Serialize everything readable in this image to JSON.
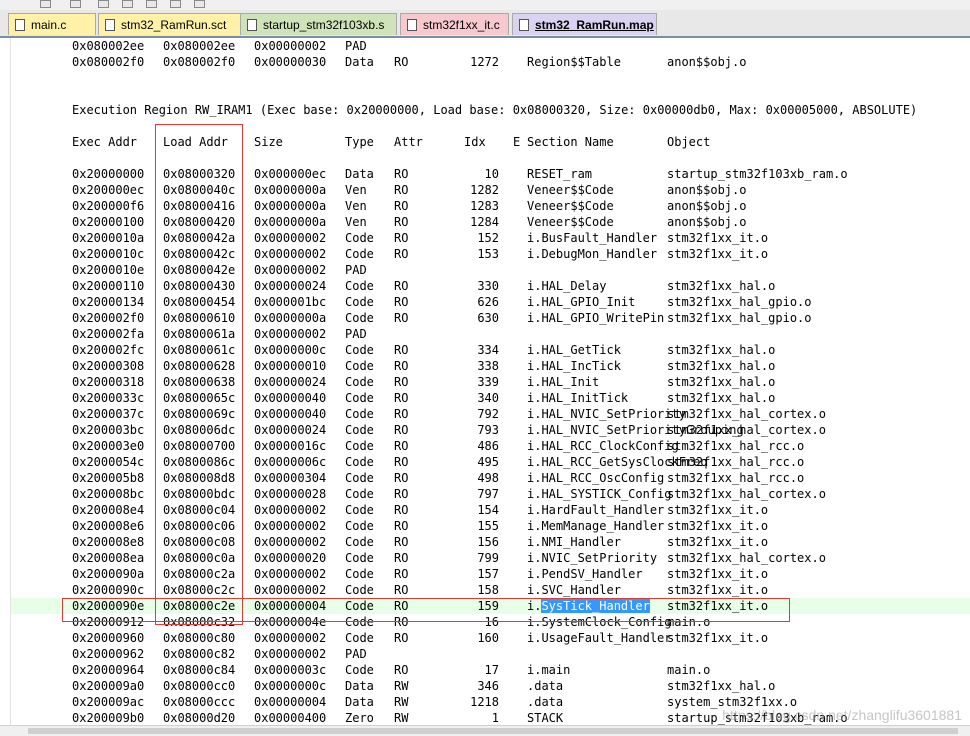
{
  "tabs": [
    {
      "label": "main.c",
      "color": "#fff2a8",
      "active": false
    },
    {
      "label": "stm32_RamRun.sct",
      "color": "#fff2a8",
      "active": false
    },
    {
      "label": "startup_stm32f103xb.s",
      "color": "#cfe3b8",
      "active": false
    },
    {
      "label": "stm32f1xx_it.c",
      "color": "#f7c9cf",
      "active": false
    },
    {
      "label": "stm32_RamRun.map",
      "color": "#d9d2f0",
      "active": true
    }
  ],
  "pre_lines": [
    [
      "0x080002ee",
      "0x080002ee",
      "0x00000002",
      "PAD",
      "",
      "",
      "",
      ""
    ],
    [
      "0x080002f0",
      "0x080002f0",
      "0x00000030",
      "Data",
      "RO",
      "1272",
      "Region$$Table",
      "anon$$obj.o"
    ]
  ],
  "execution_region": "Execution Region RW_IRAM1 (Exec base: 0x20000000, Load base: 0x08000320, Size: 0x00000db0, Max: 0x00005000, ABSOLUTE)",
  "columns": {
    "exec": "Exec Addr",
    "load": "Load Addr",
    "size": "Size",
    "type": "Type",
    "attr": "Attr",
    "idx": "Idx",
    "e": "E",
    "section": "Section Name",
    "object": "Object"
  },
  "rows": [
    [
      "0x20000000",
      "0x08000320",
      "0x000000ec",
      "Data",
      "RO",
      "10",
      "RESET_ram",
      "startup_stm32f103xb_ram.o"
    ],
    [
      "0x200000ec",
      "0x0800040c",
      "0x0000000a",
      "Ven",
      "RO",
      "1282",
      "Veneer$$Code",
      "anon$$obj.o"
    ],
    [
      "0x200000f6",
      "0x08000416",
      "0x0000000a",
      "Ven",
      "RO",
      "1283",
      "Veneer$$Code",
      "anon$$obj.o"
    ],
    [
      "0x20000100",
      "0x08000420",
      "0x0000000a",
      "Ven",
      "RO",
      "1284",
      "Veneer$$Code",
      "anon$$obj.o"
    ],
    [
      "0x2000010a",
      "0x0800042a",
      "0x00000002",
      "Code",
      "RO",
      "152",
      "i.BusFault_Handler",
      "stm32f1xx_it.o"
    ],
    [
      "0x2000010c",
      "0x0800042c",
      "0x00000002",
      "Code",
      "RO",
      "153",
      "i.DebugMon_Handler",
      "stm32f1xx_it.o"
    ],
    [
      "0x2000010e",
      "0x0800042e",
      "0x00000002",
      "PAD",
      "",
      "",
      "",
      ""
    ],
    [
      "0x20000110",
      "0x08000430",
      "0x00000024",
      "Code",
      "RO",
      "330",
      "i.HAL_Delay",
      "stm32f1xx_hal.o"
    ],
    [
      "0x20000134",
      "0x08000454",
      "0x000001bc",
      "Code",
      "RO",
      "626",
      "i.HAL_GPIO_Init",
      "stm32f1xx_hal_gpio.o"
    ],
    [
      "0x200002f0",
      "0x08000610",
      "0x0000000a",
      "Code",
      "RO",
      "630",
      "i.HAL_GPIO_WritePin",
      "stm32f1xx_hal_gpio.o"
    ],
    [
      "0x200002fa",
      "0x0800061a",
      "0x00000002",
      "PAD",
      "",
      "",
      "",
      ""
    ],
    [
      "0x200002fc",
      "0x0800061c",
      "0x0000000c",
      "Code",
      "RO",
      "334",
      "i.HAL_GetTick",
      "stm32f1xx_hal.o"
    ],
    [
      "0x20000308",
      "0x08000628",
      "0x00000010",
      "Code",
      "RO",
      "338",
      "i.HAL_IncTick",
      "stm32f1xx_hal.o"
    ],
    [
      "0x20000318",
      "0x08000638",
      "0x00000024",
      "Code",
      "RO",
      "339",
      "i.HAL_Init",
      "stm32f1xx_hal.o"
    ],
    [
      "0x2000033c",
      "0x0800065c",
      "0x00000040",
      "Code",
      "RO",
      "340",
      "i.HAL_InitTick",
      "stm32f1xx_hal.o"
    ],
    [
      "0x2000037c",
      "0x0800069c",
      "0x00000040",
      "Code",
      "RO",
      "792",
      "i.HAL_NVIC_SetPriority",
      "stm32f1xx_hal_cortex.o"
    ],
    [
      "0x200003bc",
      "0x080006dc",
      "0x00000024",
      "Code",
      "RO",
      "793",
      "i.HAL_NVIC_SetPriorityGrouping",
      "stm32f1xx_hal_cortex.o"
    ],
    [
      "0x200003e0",
      "0x08000700",
      "0x0000016c",
      "Code",
      "RO",
      "486",
      "i.HAL_RCC_ClockConfig",
      "stm32f1xx_hal_rcc.o"
    ],
    [
      "0x2000054c",
      "0x0800086c",
      "0x0000006c",
      "Code",
      "RO",
      "495",
      "i.HAL_RCC_GetSysClockFreq",
      "stm32f1xx_hal_rcc.o"
    ],
    [
      "0x200005b8",
      "0x080008d8",
      "0x00000304",
      "Code",
      "RO",
      "498",
      "i.HAL_RCC_OscConfig",
      "stm32f1xx_hal_rcc.o"
    ],
    [
      "0x200008bc",
      "0x08000bdc",
      "0x00000028",
      "Code",
      "RO",
      "797",
      "i.HAL_SYSTICK_Config",
      "stm32f1xx_hal_cortex.o"
    ],
    [
      "0x200008e4",
      "0x08000c04",
      "0x00000002",
      "Code",
      "RO",
      "154",
      "i.HardFault_Handler",
      "stm32f1xx_it.o"
    ],
    [
      "0x200008e6",
      "0x08000c06",
      "0x00000002",
      "Code",
      "RO",
      "155",
      "i.MemManage_Handler",
      "stm32f1xx_it.o"
    ],
    [
      "0x200008e8",
      "0x08000c08",
      "0x00000002",
      "Code",
      "RO",
      "156",
      "i.NMI_Handler",
      "stm32f1xx_it.o"
    ],
    [
      "0x200008ea",
      "0x08000c0a",
      "0x00000020",
      "Code",
      "RO",
      "799",
      "i.NVIC_SetPriority",
      "stm32f1xx_hal_cortex.o"
    ],
    [
      "0x2000090a",
      "0x08000c2a",
      "0x00000002",
      "Code",
      "RO",
      "157",
      "i.PendSV_Handler",
      "stm32f1xx_it.o"
    ],
    [
      "0x2000090c",
      "0x08000c2c",
      "0x00000002",
      "Code",
      "RO",
      "158",
      "i.SVC_Handler",
      "stm32f1xx_it.o"
    ],
    [
      "0x2000090e",
      "0x08000c2e",
      "0x00000004",
      "Code",
      "RO",
      "159",
      "i.SysTick_Handler",
      "stm32f1xx_it.o"
    ],
    [
      "0x20000912",
      "0x08000c32",
      "0x0000004e",
      "Code",
      "RO",
      "16",
      "i.SystemClock_Config",
      "main.o"
    ],
    [
      "0x20000960",
      "0x08000c80",
      "0x00000002",
      "Code",
      "RO",
      "160",
      "i.UsageFault_Handler",
      "stm32f1xx_it.o"
    ],
    [
      "0x20000962",
      "0x08000c82",
      "0x00000002",
      "PAD",
      "",
      "",
      "",
      ""
    ],
    [
      "0x20000964",
      "0x08000c84",
      "0x0000003c",
      "Code",
      "RO",
      "17",
      "i.main",
      "main.o"
    ],
    [
      "0x200009a0",
      "0x08000cc0",
      "0x0000000c",
      "Data",
      "RW",
      "346",
      ".data",
      "stm32f1xx_hal.o"
    ],
    [
      "0x200009ac",
      "0x08000ccc",
      "0x00000004",
      "Data",
      "RW",
      "1218",
      ".data",
      "system_stm32f1xx.o"
    ],
    [
      "0x200009b0",
      "0x08000d20",
      "0x00000400",
      "Zero",
      "RW",
      "1",
      "STACK",
      "startup_stm32f103xb_ram.o"
    ]
  ],
  "highlight": {
    "row": 27,
    "selected": "SysTick_Handler"
  },
  "watermark": "https://blog.csdn.net/zhanglifu3601881"
}
